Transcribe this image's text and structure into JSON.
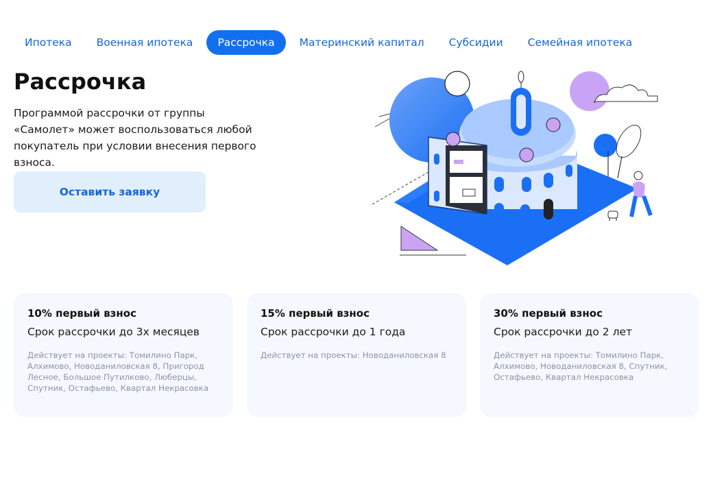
{
  "tabs": [
    {
      "label": "Ипотека",
      "active": false
    },
    {
      "label": "Военная ипотека",
      "active": false
    },
    {
      "label": "Рассрочка",
      "active": true
    },
    {
      "label": "Материнский капитал",
      "active": false
    },
    {
      "label": "Субсидии",
      "active": false
    },
    {
      "label": "Семейная ипотека",
      "active": false
    }
  ],
  "hero": {
    "title": "Рассрочка",
    "description": "Программой рассрочки от группы «Самолет» может воспользоваться любой покупатель при условии внесения первого взноса.",
    "cta_label": "Оставить заявку",
    "illustration_icon": "building-cake-illustration"
  },
  "cards": [
    {
      "title": "10% первый взнос",
      "term": "Срок рассрочки до 3х месяцев",
      "projects": "Действует на проекты: Томилино Парк, Алхимово, Новоданиловская 8, Пригород Лесное, Большое Путилково, Люберцы, Спутник, Остафьево, Квартал Некрасовка"
    },
    {
      "title": "15% первый взнос",
      "term": "Срок рассрочки до 1 года",
      "projects": "Действует на проекты: Новоданиловская 8"
    },
    {
      "title": "30% первый взнос",
      "term": "Срок рассрочки до 2 лет",
      "projects": "Действует на проекты: Томилино Парк, Алхимово, Новоданиловская 8, Спутник, Остафьево, Квартал Некрасовка"
    }
  ],
  "colors": {
    "accent": "#1270f0",
    "link": "#1565d8",
    "cta_bg": "#e1eefc",
    "card_bg": "#f5f8fe",
    "muted_text": "#8c94a0",
    "illustration_blue": "#1a6ff5",
    "illustration_light_blue": "#a9c9ff",
    "illustration_purple": "#c9a4f5"
  }
}
